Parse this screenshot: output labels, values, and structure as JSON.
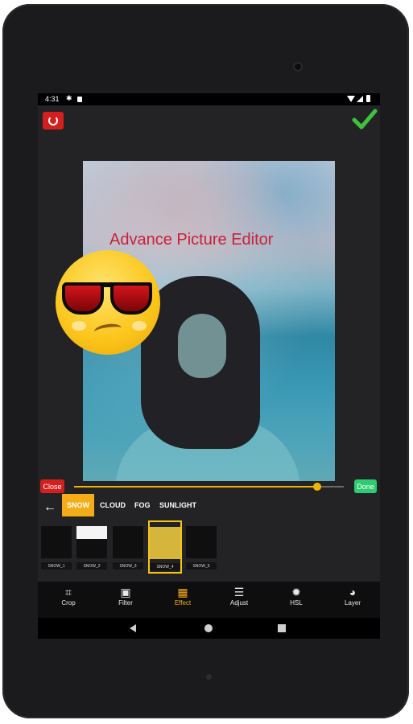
{
  "status_bar": {
    "time": "4:31"
  },
  "photo_overlay_text": "Advance Picture Editor",
  "effect_controls": {
    "close_label": "Close",
    "done_label": "Done",
    "intensity": 0.9
  },
  "categories": [
    {
      "label": "SNOW",
      "active": true
    },
    {
      "label": "CLOUD",
      "active": false
    },
    {
      "label": "FOG",
      "active": false
    },
    {
      "label": "SUNLIGHT",
      "active": false
    }
  ],
  "effect_thumbnails": [
    {
      "label": "SNOW_1",
      "selected": false
    },
    {
      "label": "SNOW_2",
      "selected": false
    },
    {
      "label": "SNOW_3",
      "selected": false
    },
    {
      "label": "SNOW_4",
      "selected": true
    },
    {
      "label": "SNOW_5",
      "selected": false
    }
  ],
  "tools": [
    {
      "label": "Crop",
      "icon": "crop-icon",
      "active": false
    },
    {
      "label": "Filter",
      "icon": "filter-icon",
      "active": false
    },
    {
      "label": "Effect",
      "icon": "effect-icon",
      "active": true
    },
    {
      "label": "Adjust",
      "icon": "adjust-icon",
      "active": false
    },
    {
      "label": "HSL",
      "icon": "hsl-icon",
      "active": false
    },
    {
      "label": "Layer",
      "icon": "layer-icon",
      "active": false
    }
  ],
  "colors": {
    "accent": "#f5ad17",
    "close": "#d41f1f",
    "done": "#2ecc71",
    "confirm": "#3cc43c",
    "overlay_text": "#c8213a"
  }
}
